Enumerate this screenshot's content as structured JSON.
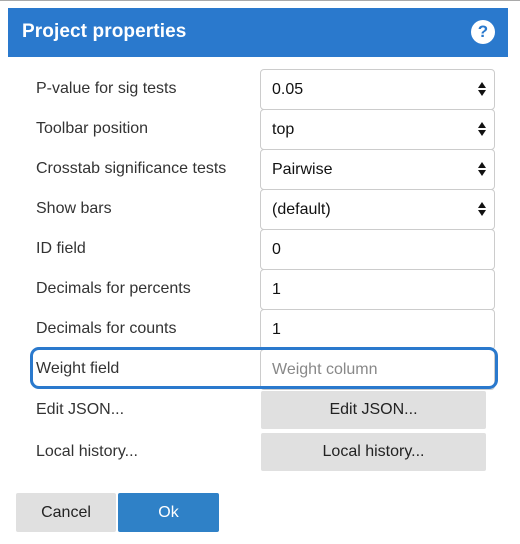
{
  "header": {
    "title": "Project properties",
    "help_icon": "?"
  },
  "fields": [
    {
      "label": "P-value for sig tests",
      "type": "select",
      "value": "0.05"
    },
    {
      "label": "Toolbar position",
      "type": "select",
      "value": "top"
    },
    {
      "label": "Crosstab significance tests",
      "type": "select",
      "value": "Pairwise"
    },
    {
      "label": "Show bars",
      "type": "select",
      "value": "(default)"
    },
    {
      "label": "ID field",
      "type": "input",
      "value": "0"
    },
    {
      "label": "Decimals for percents",
      "type": "input",
      "value": "1"
    },
    {
      "label": "Decimals for counts",
      "type": "input",
      "value": "1"
    },
    {
      "label": "Weight field",
      "type": "input",
      "value": "",
      "placeholder": "Weight column"
    }
  ],
  "actions": [
    {
      "label": "Edit JSON...",
      "button_label": "Edit JSON..."
    },
    {
      "label": "Local history...",
      "button_label": "Local history..."
    }
  ],
  "footer": {
    "cancel_label": "Cancel",
    "ok_label": "Ok"
  },
  "colors": {
    "accent": "#2a79cd",
    "ok_button": "#2f81c7",
    "gray_button": "#e0e0e0"
  }
}
